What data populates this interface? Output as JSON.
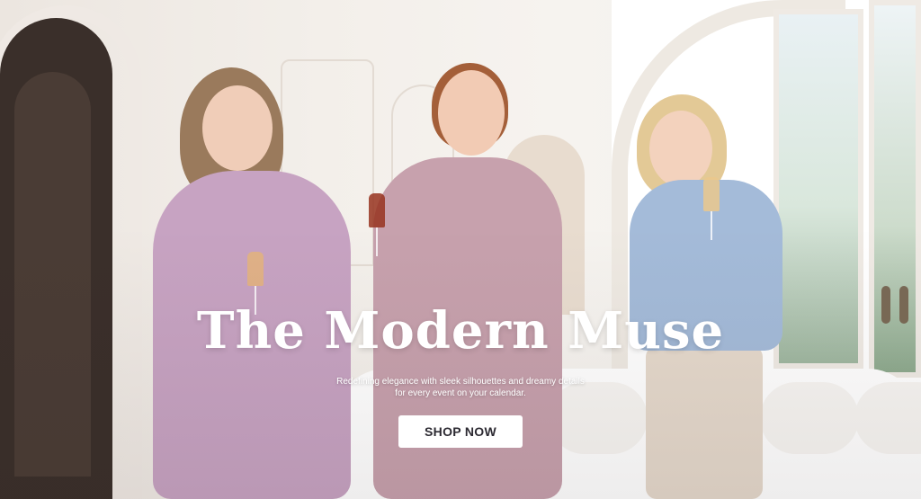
{
  "hero": {
    "title": "The Modern Muse",
    "tagline_line1": "Redefining elegance with sleek silhouettes and dreamy details",
    "tagline_line2": "for every event on your calendar.",
    "cta_label": "SHOP NOW"
  },
  "colors": {
    "text": "#ffffff",
    "button_bg": "#ffffff",
    "button_text": "#2c2a32"
  }
}
